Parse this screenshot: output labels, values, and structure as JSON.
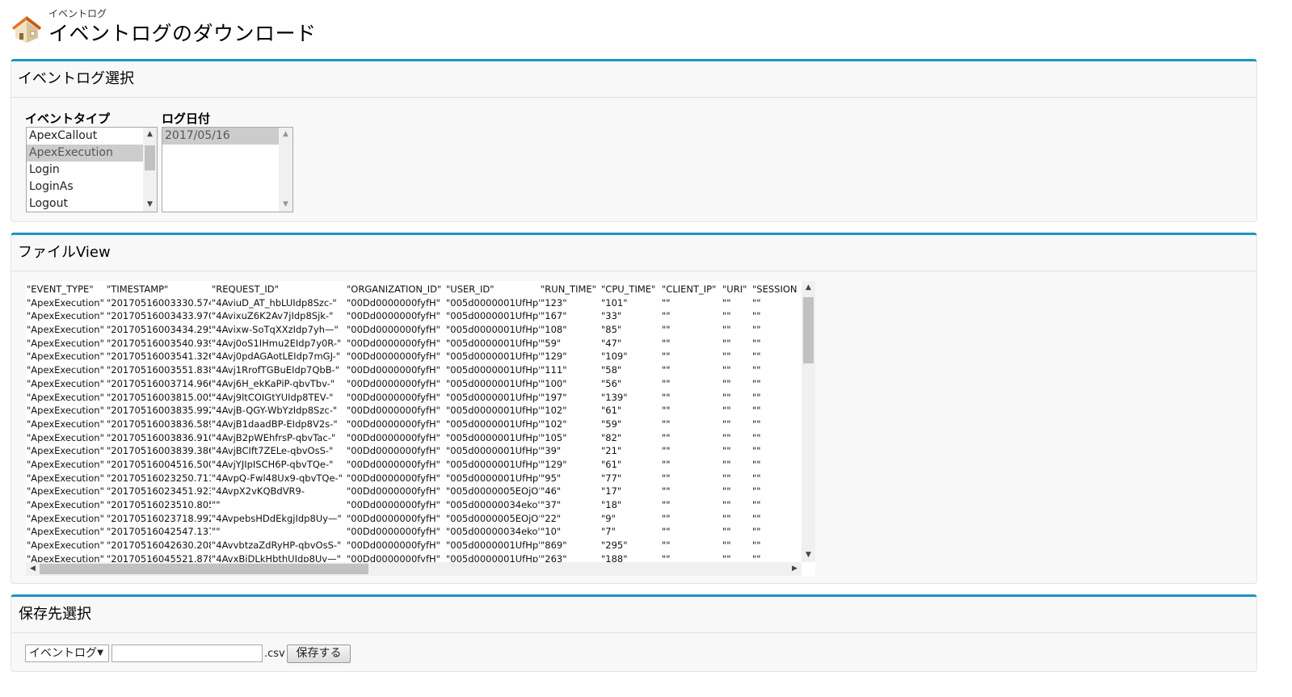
{
  "header": {
    "subtitle": "イベントログ",
    "title": "イベントログのダウンロード"
  },
  "select_section": {
    "title": "イベントログ選択",
    "event_type_label": "イベントタイプ",
    "event_types": [
      "ApexCallout",
      "ApexExecution",
      "Login",
      "LoginAs",
      "Logout"
    ],
    "event_type_selected": "ApexExecution",
    "log_date_label": "ログ日付",
    "log_dates": [
      "2017/05/16"
    ],
    "log_date_selected": "2017/05/16"
  },
  "file_section": {
    "title": "ファイルView",
    "columns": [
      "\"EVENT_TYPE\"",
      "\"TIMESTAMP\"",
      "\"REQUEST_ID\"",
      "\"ORGANIZATION_ID\"",
      "\"USER_ID\"",
      "\"RUN_TIME\"",
      "\"CPU_TIME\"",
      "\"CLIENT_IP\"",
      "\"URI\"",
      "\"SESSION"
    ],
    "rows": [
      [
        "\"ApexExecution\"",
        "\"20170516003330.574\"",
        "\"4AviuD_AT_hbLUIdp8Szc-\"",
        "\"00Dd0000000fyfH\"",
        "\"005d0000001UfHp\"",
        "\"123\"",
        "\"101\"",
        "\"\"",
        "\"\"",
        "\"\""
      ],
      [
        "\"ApexExecution\"",
        "\"20170516003433.970\"",
        "\"4AvixuZ6K2Av7jIdp8Sjk-\"",
        "\"00Dd0000000fyfH\"",
        "\"005d0000001UfHp\"",
        "\"167\"",
        "\"33\"",
        "\"\"",
        "\"\"",
        "\"\""
      ],
      [
        "\"ApexExecution\"",
        "\"20170516003434.295\"",
        "\"4Avixw-SoTqXXzIdp7yh—\"",
        "\"00Dd0000000fyfH\"",
        "\"005d0000001UfHp\"",
        "\"108\"",
        "\"85\"",
        "\"\"",
        "\"\"",
        "\"\""
      ],
      [
        "\"ApexExecution\"",
        "\"20170516003540.939\"",
        "\"4Avj0oS1IHmu2EIdp7y0R-\"",
        "\"00Dd0000000fyfH\"",
        "\"005d0000001UfHp\"",
        "\"59\"",
        "\"47\"",
        "\"\"",
        "\"\"",
        "\"\""
      ],
      [
        "\"ApexExecution\"",
        "\"20170516003541.326\"",
        "\"4Avj0pdAGAotLEIdp7mGJ-\"",
        "\"00Dd0000000fyfH\"",
        "\"005d0000001UfHp\"",
        "\"129\"",
        "\"109\"",
        "\"\"",
        "\"\"",
        "\"\""
      ],
      [
        "\"ApexExecution\"",
        "\"20170516003551.838\"",
        "\"4Avj1RrofTGBuEIdp7QbB-\"",
        "\"00Dd0000000fyfH\"",
        "\"005d0000001UfHp\"",
        "\"111\"",
        "\"58\"",
        "\"\"",
        "\"\"",
        "\"\""
      ],
      [
        "\"ApexExecution\"",
        "\"20170516003714.966\"",
        "\"4Avj6H_ekKaPiP-qbvTbv-\"",
        "\"00Dd0000000fyfH\"",
        "\"005d0000001UfHp\"",
        "\"100\"",
        "\"56\"",
        "\"\"",
        "\"\"",
        "\"\""
      ],
      [
        "\"ApexExecution\"",
        "\"20170516003815.005\"",
        "\"4Avj9ltCOIGtYUIdp8TEV-\"",
        "\"00Dd0000000fyfH\"",
        "\"005d0000001UfHp\"",
        "\"197\"",
        "\"139\"",
        "\"\"",
        "\"\"",
        "\"\""
      ],
      [
        "\"ApexExecution\"",
        "\"20170516003835.992\"",
        "\"4AvjB-QGY-WbYzIdp8Szc-\"",
        "\"00Dd0000000fyfH\"",
        "\"005d0000001UfHp\"",
        "\"102\"",
        "\"61\"",
        "\"\"",
        "\"\"",
        "\"\""
      ],
      [
        "\"ApexExecution\"",
        "\"20170516003836.589\"",
        "\"4AvjB1daadBP-EIdp8V2s-\"",
        "\"00Dd0000000fyfH\"",
        "\"005d0000001UfHp\"",
        "\"102\"",
        "\"59\"",
        "\"\"",
        "\"\"",
        "\"\""
      ],
      [
        "\"ApexExecution\"",
        "\"20170516003836.910\"",
        "\"4AvjB2pWEhfrsP-qbvTac-\"",
        "\"00Dd0000000fyfH\"",
        "\"005d0000001UfHp\"",
        "\"105\"",
        "\"82\"",
        "\"\"",
        "\"\"",
        "\"\""
      ],
      [
        "\"ApexExecution\"",
        "\"20170516003839.386\"",
        "\"4AvjBCIft7ZELe-qbvOsS-\"",
        "\"00Dd0000000fyfH\"",
        "\"005d0000001UfHp\"",
        "\"39\"",
        "\"21\"",
        "\"\"",
        "\"\"",
        "\"\""
      ],
      [
        "\"ApexExecution\"",
        "\"20170516004516.500\"",
        "\"4AvjYJIpISCH6P-qbvTQe-\"",
        "\"00Dd0000000fyfH\"",
        "\"005d0000001UfHp\"",
        "\"129\"",
        "\"61\"",
        "\"\"",
        "\"\"",
        "\"\""
      ],
      [
        "\"ApexExecution\"",
        "\"20170516023250.711\"",
        "\"4AvpQ-Fwl48Ux9-qbvTQe-\"",
        "\"00Dd0000000fyfH\"",
        "\"005d0000001UfHp\"",
        "\"95\"",
        "\"77\"",
        "\"\"",
        "\"\"",
        "\"\""
      ],
      [
        "\"ApexExecution\"",
        "\"20170516023451.923\"",
        "\"4AvpX2vKQBdVR9-",
        "\"00Dd0000000fyfH\"",
        "\"005d0000005EOjO\"",
        "\"46\"",
        "\"17\"",
        "\"\"",
        "\"\"",
        "\"\""
      ],
      [
        "\"ApexExecution\"",
        "\"20170516023510.805\"",
        "\"\"",
        "\"00Dd0000000fyfH\"",
        "\"005d00000034eko\"",
        "\"37\"",
        "\"18\"",
        "\"\"",
        "\"\"",
        "\"\""
      ],
      [
        "\"ApexExecution\"",
        "\"20170516023718.992\"",
        "\"4AvpebsHDdEkgjIdp8Uy—\"",
        "\"00Dd0000000fyfH\"",
        "\"005d0000005EOjO\"",
        "\"22\"",
        "\"9\"",
        "\"\"",
        "\"\"",
        "\"\""
      ],
      [
        "\"ApexExecution\"",
        "\"20170516042547.137\"",
        "\"\"",
        "\"00Dd0000000fyfH\"",
        "\"005d00000034eko\"",
        "\"10\"",
        "\"7\"",
        "\"\"",
        "\"\"",
        "\"\""
      ],
      [
        "\"ApexExecution\"",
        "\"20170516042630.208\"",
        "\"4AvvbtzaZdRyHP-qbvOsS-\"",
        "\"00Dd0000000fyfH\"",
        "\"005d0000001UfHp\"",
        "\"869\"",
        "\"295\"",
        "\"\"",
        "\"\"",
        "\"\""
      ],
      [
        "\"ApexExecution\"",
        "\"20170516045521.878\"",
        "\"4AvxBiDLkHbthUIdp8Uy—\"",
        "\"00Dd0000000fyfH\"",
        "\"005d0000001UfHp\"",
        "\"263\"",
        "\"188\"",
        "\"\"",
        "\"\"",
        "\"\""
      ]
    ]
  },
  "save_section": {
    "title": "保存先選択",
    "folder_selected": "イベントログ",
    "filename_value": "",
    "extension": ".csv",
    "save_label": "保存する"
  },
  "colors": {
    "accent": "#1797c0",
    "section_bg": "#f8f8f8",
    "selected_option": "#cccccc"
  },
  "icons": {
    "header": "house-icon"
  }
}
